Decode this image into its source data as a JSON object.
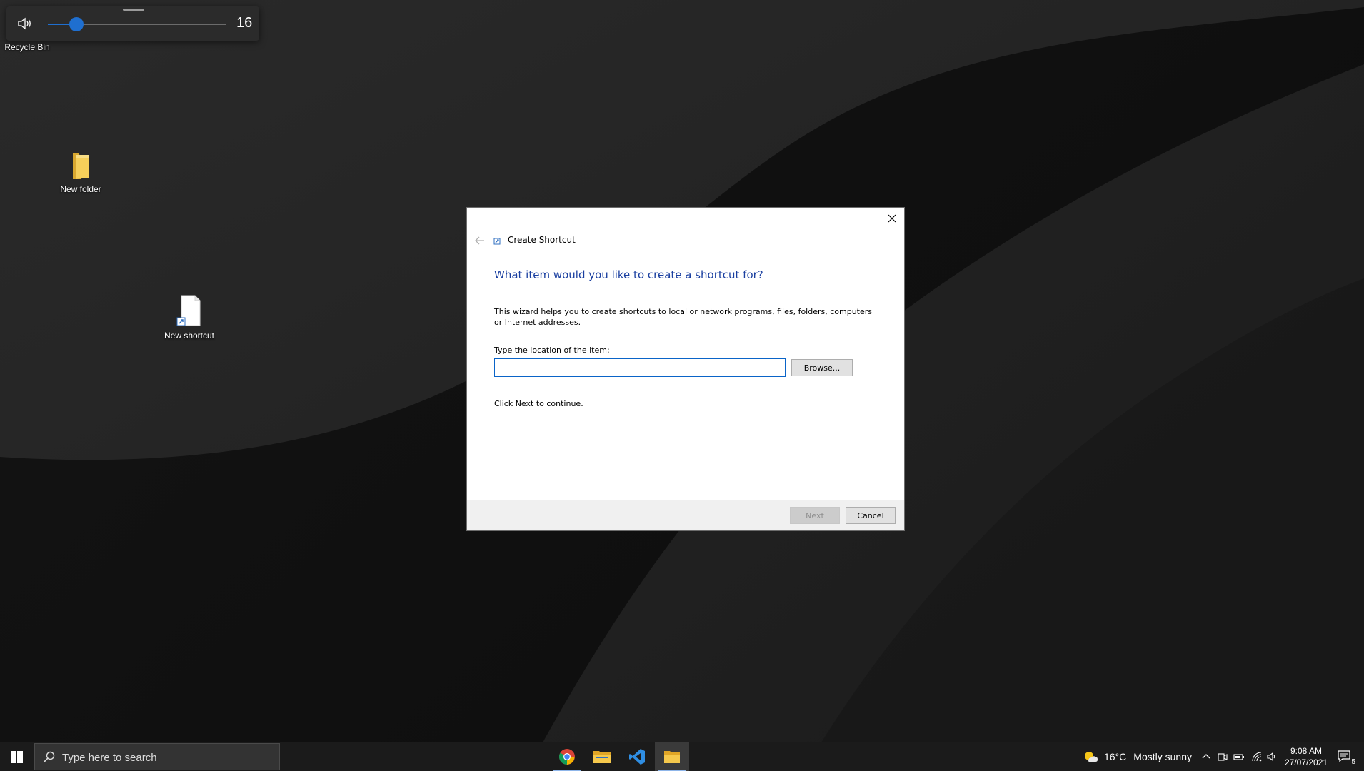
{
  "volume": {
    "icon": "speaker-icon",
    "value": "16",
    "level_percent": 16,
    "accent": "#1f6fd0"
  },
  "desktop": {
    "icons": [
      {
        "label": "Recycle Bin",
        "icon": "recycle-bin-icon"
      },
      {
        "label": "New folder",
        "icon": "folder-icon"
      },
      {
        "label": "New shortcut",
        "icon": "shortcut-file-icon"
      }
    ]
  },
  "dialog": {
    "title": "Create Shortcut",
    "heading": "What item would you like to create a shortcut for?",
    "description": "This wizard helps you to create shortcuts to local or network programs, files, folders, computers or Internet addresses.",
    "location_label": "Type the location of the item:",
    "location_value": "",
    "browse_label": "Browse...",
    "hint": "Click Next to continue.",
    "next_label": "Next",
    "cancel_label": "Cancel",
    "heading_color": "#1a3fa0"
  },
  "taskbar": {
    "search_placeholder": "Type here to search",
    "apps": [
      {
        "name": "chrome",
        "icon": "chrome-icon"
      },
      {
        "name": "file-explorer",
        "icon": "folder-icon"
      },
      {
        "name": "vscode",
        "icon": "vscode-icon"
      },
      {
        "name": "file-explorer-active",
        "icon": "file-explorer-icon"
      }
    ],
    "weather": {
      "temp": "16°C",
      "condition": "Mostly sunny"
    },
    "clock": {
      "time": "9:08 AM",
      "date": "27/07/2021"
    },
    "notification_count": "5"
  }
}
